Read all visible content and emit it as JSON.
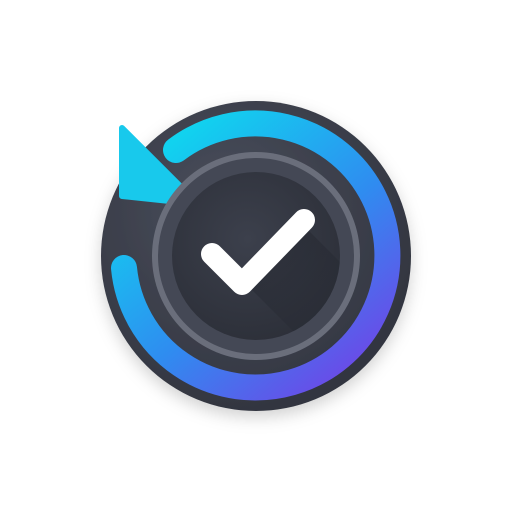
{
  "icon": {
    "name": "sync-check-icon",
    "description_free": true,
    "colors": {
      "background": "#ffffff",
      "outer_disc": "#3f4350",
      "outer_disc_edge": "#2d3039",
      "inner_ring": "#6a6e7b",
      "inner_disc": "#343844",
      "inner_disc_shadow": "#262932",
      "ring_gradient_start": "#11d2ef",
      "ring_gradient_mid": "#2f8cf0",
      "ring_gradient_end": "#6a4be8",
      "arrow": "#18c9ec",
      "check": "#ffffff"
    }
  }
}
